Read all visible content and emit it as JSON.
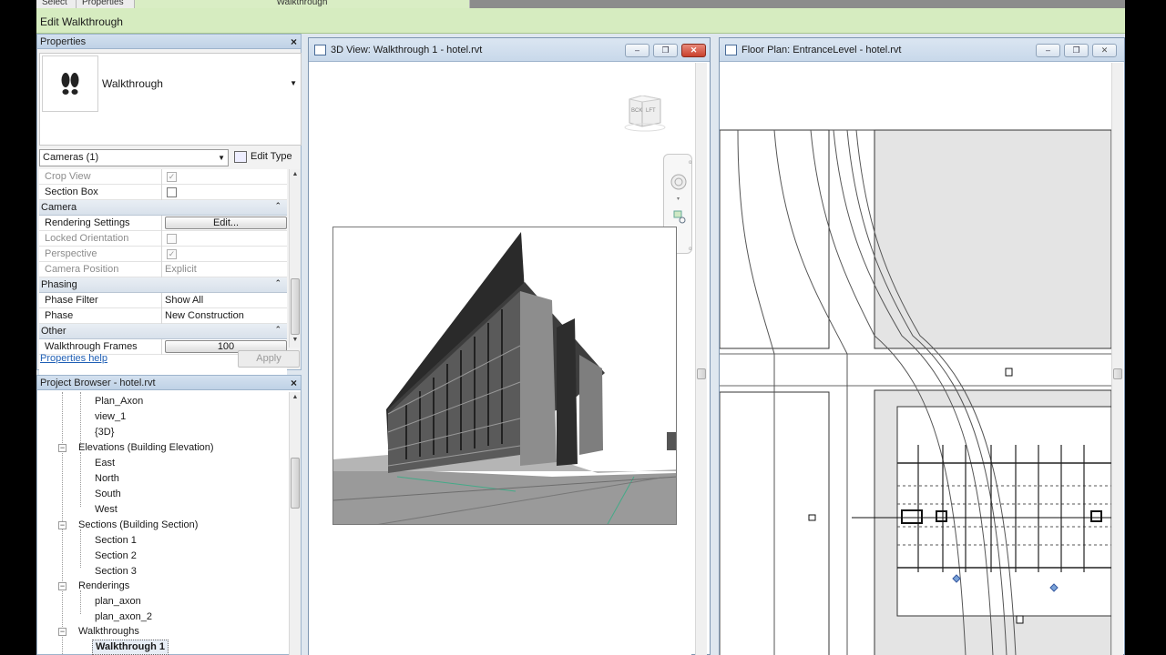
{
  "ribbon": {
    "tabs": [
      "Select",
      "Properties"
    ],
    "context_tab": "Walkthrough",
    "context_label": "Edit Walkthrough"
  },
  "properties": {
    "title": "Properties",
    "close": "×",
    "type_icon": "footsteps-icon",
    "type_name": "Walkthrough",
    "filter": "Cameras (1)",
    "edit_type": "Edit Type",
    "rows": {
      "crop_view": "Crop View",
      "section_box": "Section Box",
      "group_camera": "Camera",
      "rendering_settings": "Rendering Settings",
      "rendering_settings_btn": "Edit...",
      "locked_orientation": "Locked Orientation",
      "perspective": "Perspective",
      "camera_position": "Camera Position",
      "camera_position_value": "Explicit",
      "group_phasing": "Phasing",
      "phase_filter": "Phase Filter",
      "phase_filter_value": "Show All",
      "phase": "Phase",
      "phase_value": "New Construction",
      "group_other": "Other",
      "walkthrough_frames": "Walkthrough Frames",
      "walkthrough_frames_value": "100"
    },
    "help_link": "Properties help",
    "apply": "Apply"
  },
  "browser": {
    "title": "Project Browser - hotel.rvt",
    "close": "×",
    "items": {
      "plan_axon": "Plan_Axon",
      "view_1": "view_1",
      "view_3d": "{3D}",
      "elevations": "Elevations (Building Elevation)",
      "east": "East",
      "north": "North",
      "south": "South",
      "west": "West",
      "sections": "Sections (Building Section)",
      "section_1": "Section 1",
      "section_2": "Section 2",
      "section_3": "Section 3",
      "renderings": "Renderings",
      "plan_axon_r": "plan_axon",
      "plan_axon_2": "plan_axon_2",
      "walkthroughs": "Walkthroughs",
      "walkthrough_1": "Walkthrough 1"
    }
  },
  "view3d": {
    "title": "3D View: Walkthrough 1 - hotel.rvt",
    "viewcube_faces": [
      "BCK",
      "LFT"
    ]
  },
  "floorplan": {
    "title": "Floor Plan: EntranceLevel - hotel.rvt"
  },
  "window_buttons": {
    "minimize": "‒",
    "restore": "❐",
    "close": "✕"
  }
}
